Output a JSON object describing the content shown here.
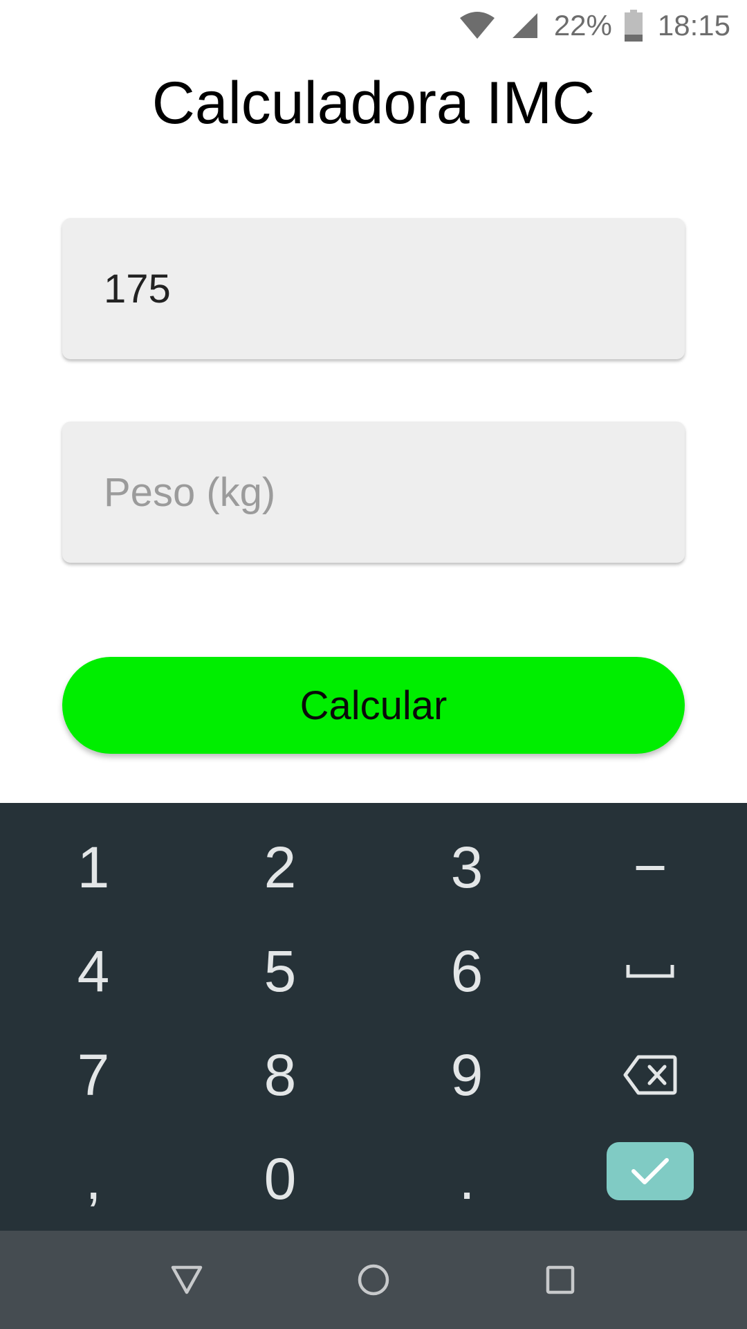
{
  "status_bar": {
    "battery_percent": "22%",
    "time": "18:15",
    "icons": [
      "wifi-icon",
      "cell-signal-icon",
      "battery-icon"
    ]
  },
  "app": {
    "title": "Calculadora IMC"
  },
  "form": {
    "height_value": "175",
    "height_placeholder": "",
    "weight_value": "",
    "weight_placeholder": "Peso (kg)",
    "calculate_label": "Calcular"
  },
  "keyboard": {
    "row1": [
      "1",
      "2",
      "3",
      "−"
    ],
    "row2": [
      "4",
      "5",
      "6"
    ],
    "row3": [
      "7",
      "8",
      "9"
    ],
    "row4": [
      ",",
      "0",
      "."
    ],
    "special_keys": [
      "space-icon",
      "backspace-icon",
      "checkmark-icon"
    ]
  },
  "nav": {
    "icons": [
      "back-icon",
      "home-icon",
      "recents-icon"
    ]
  },
  "colors": {
    "button": "#00ee00",
    "keyboard_bg": "#263238",
    "done_key": "#80cbc4",
    "field_bg": "#eeeeee",
    "nav_bg": "#454c51"
  }
}
